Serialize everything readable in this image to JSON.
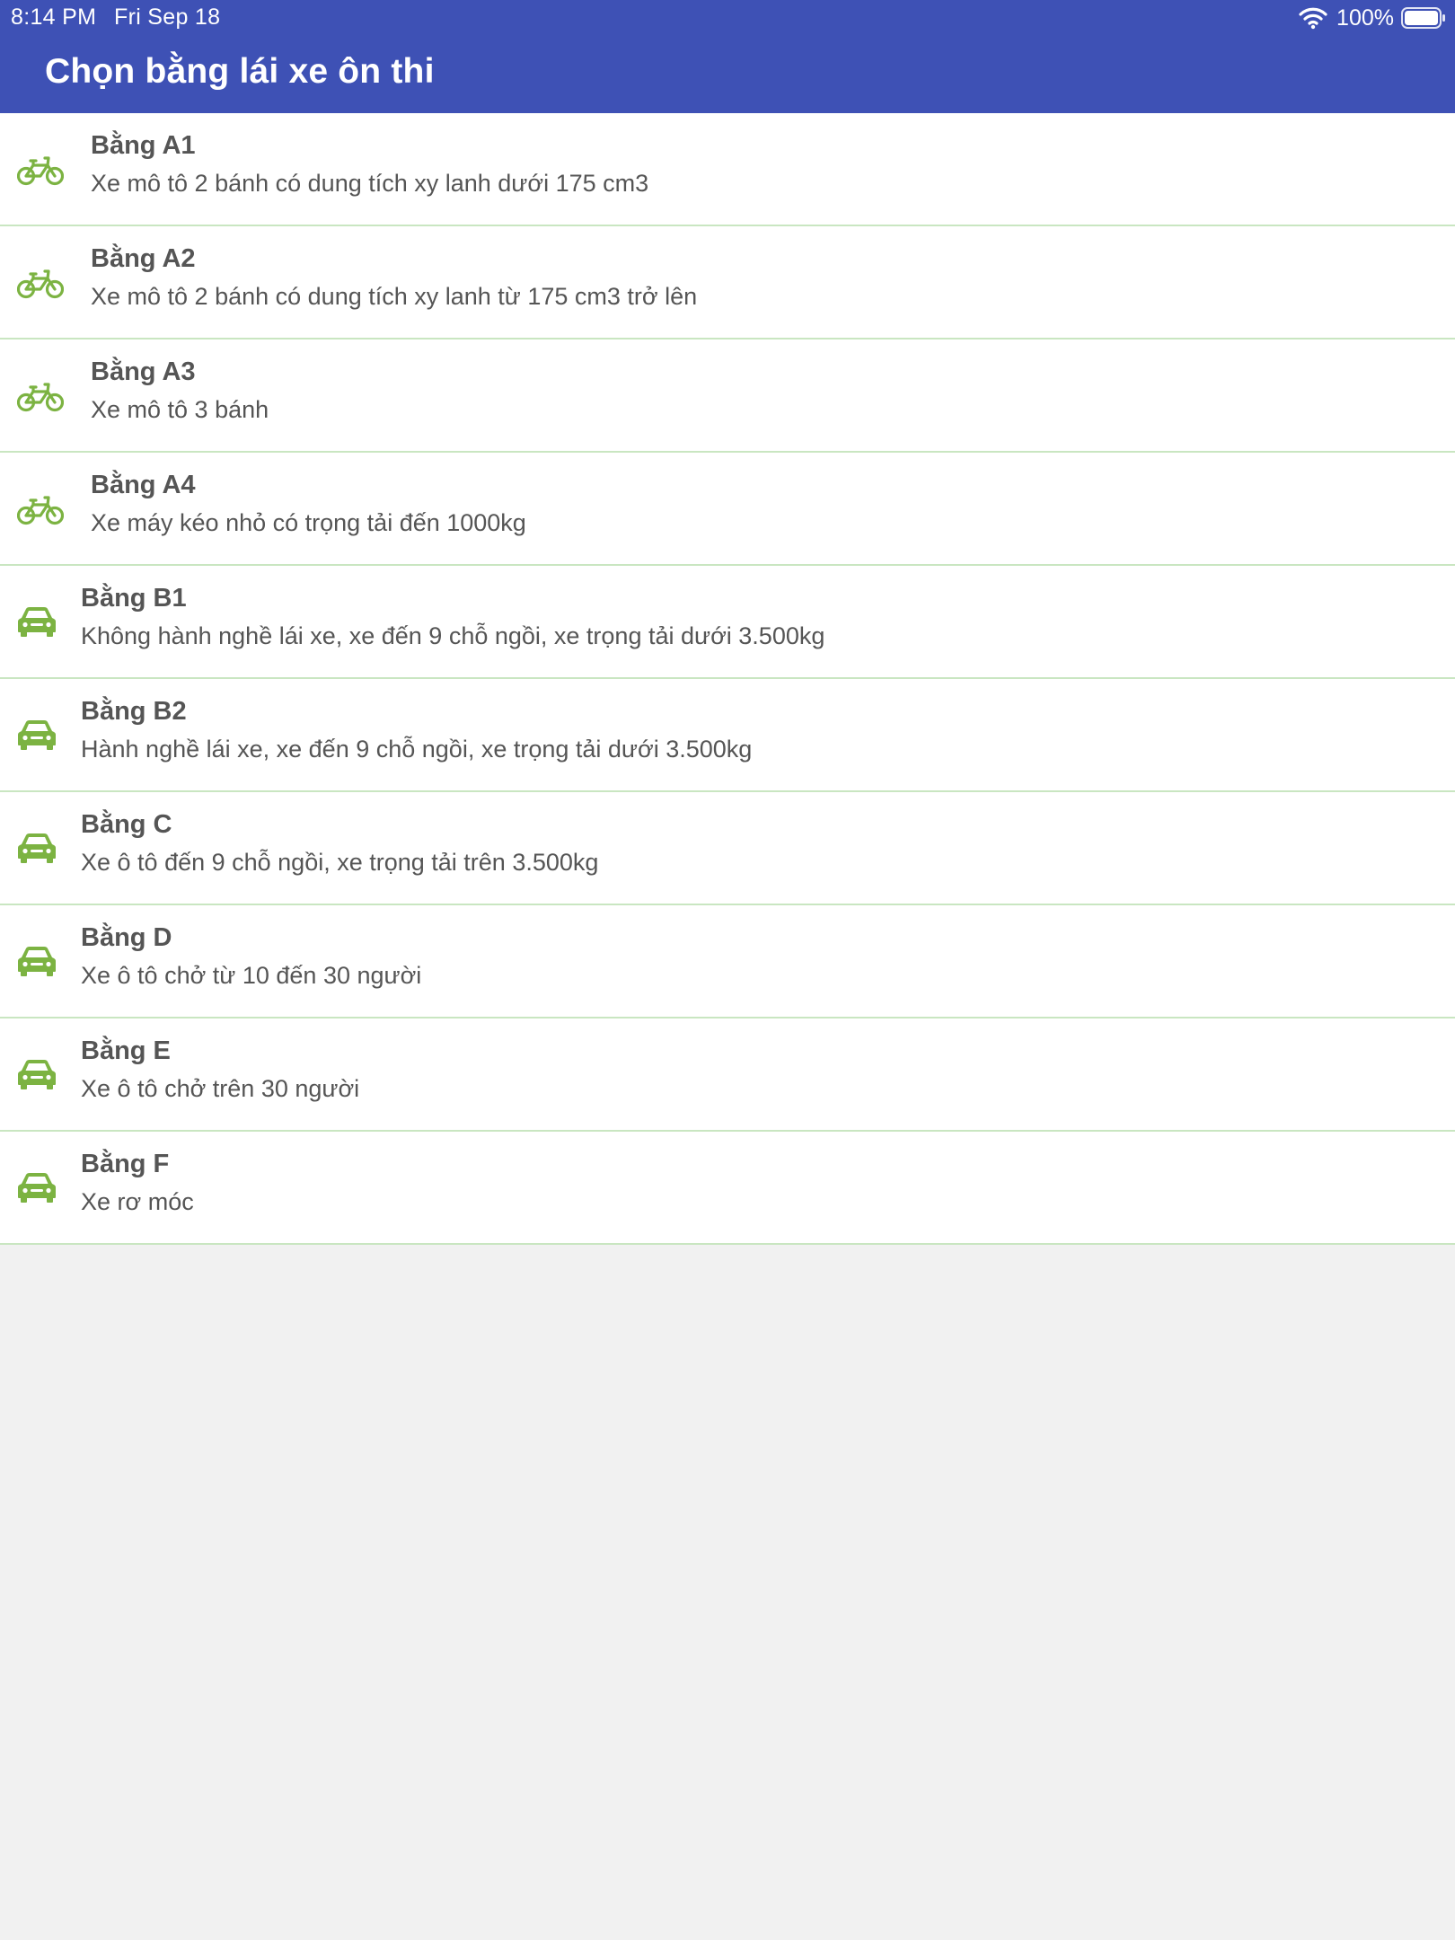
{
  "status_bar": {
    "time": "8:14 PM",
    "date": "Fri Sep 18",
    "battery": "100%",
    "wifi_icon": "wifi-icon",
    "battery_icon": "battery-icon"
  },
  "header": {
    "title": "Chọn bằng lái xe ôn thi",
    "background_color": "#3e51b5"
  },
  "list": {
    "icon_color": "#7cb342",
    "divider_color": "#c9e6c1",
    "items": [
      {
        "icon": "bicycle-icon",
        "title": "Bằng A1",
        "subtitle": "Xe mô tô 2 bánh có dung tích xy lanh dưới 175 cm3"
      },
      {
        "icon": "bicycle-icon",
        "title": "Bằng A2",
        "subtitle": "Xe mô tô 2 bánh có dung tích xy lanh từ 175 cm3 trở lên"
      },
      {
        "icon": "bicycle-icon",
        "title": "Bằng A3",
        "subtitle": "Xe mô tô 3 bánh"
      },
      {
        "icon": "bicycle-icon",
        "title": "Bằng A4",
        "subtitle": "Xe máy kéo nhỏ có trọng tải đến 1000kg"
      },
      {
        "icon": "car-icon",
        "title": "Bằng B1",
        "subtitle": "Không hành nghề lái xe, xe đến 9 chỗ ngồi, xe trọng tải dưới 3.500kg"
      },
      {
        "icon": "car-icon",
        "title": "Bằng B2",
        "subtitle": "Hành nghề lái xe, xe đến 9 chỗ ngồi, xe trọng tải dưới 3.500kg"
      },
      {
        "icon": "car-icon",
        "title": "Bằng C",
        "subtitle": "Xe ô tô đến 9 chỗ ngồi, xe trọng tải trên 3.500kg"
      },
      {
        "icon": "car-icon",
        "title": "Bằng D",
        "subtitle": "Xe ô tô chở từ 10 đến 30 người"
      },
      {
        "icon": "car-icon",
        "title": "Bằng E",
        "subtitle": "Xe ô tô chở trên 30 người"
      },
      {
        "icon": "car-icon",
        "title": "Bằng F",
        "subtitle": "Xe rơ móc"
      }
    ]
  }
}
